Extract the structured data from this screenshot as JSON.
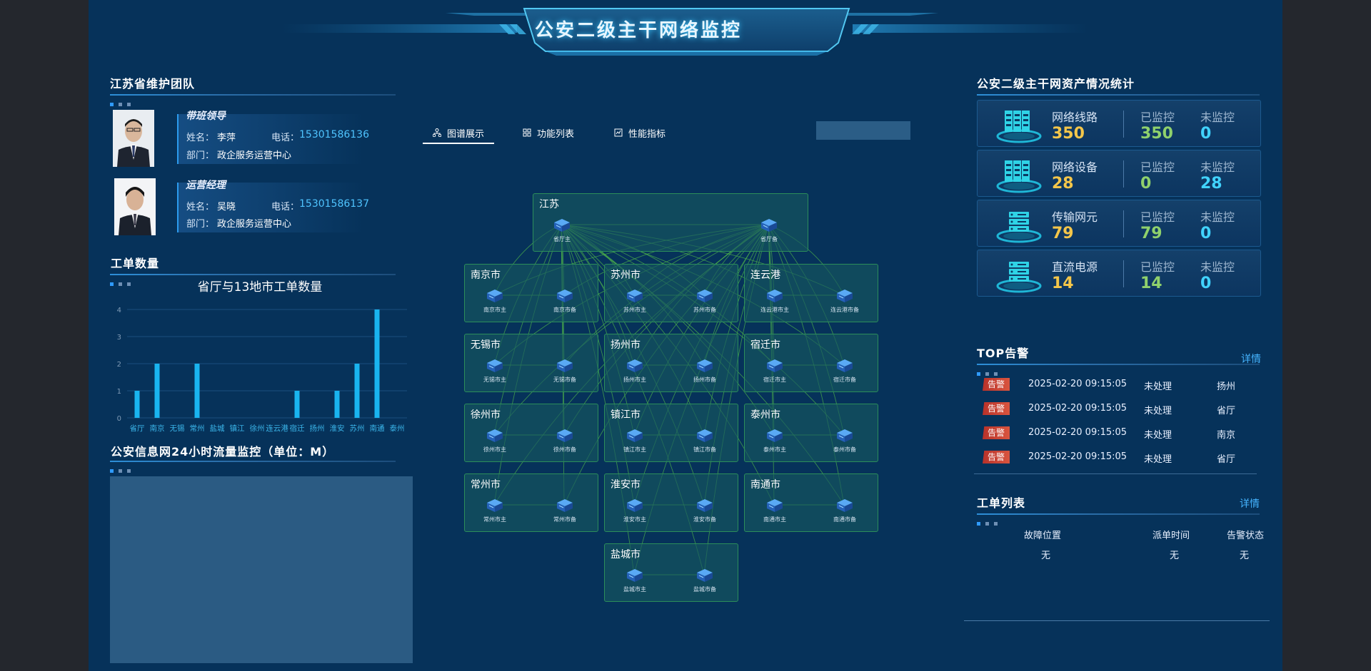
{
  "header": {
    "title": "公安二级主干网络监控"
  },
  "team": {
    "title": "江苏省维护团队",
    "members": [
      {
        "role": "带班领导",
        "name_label": "姓名：",
        "name": "李萍",
        "phone_label": "电话：",
        "phone": "15301586136",
        "dept_label": "部门：",
        "dept": "政企服务运营中心"
      },
      {
        "role": "运营经理",
        "name_label": "姓名：",
        "name": "吴晓",
        "phone_label": "电话：",
        "phone": "15301586137",
        "dept_label": "部门：",
        "dept": "政企服务运营中心"
      }
    ]
  },
  "work_count": {
    "title": "工单数量",
    "chart_data": {
      "type": "bar",
      "title": "省厅与13地市工单数量",
      "categories": [
        "省厅",
        "南京",
        "无锡",
        "常州",
        "盐城",
        "镇江",
        "徐州",
        "连云港",
        "宿迁",
        "扬州",
        "淮安",
        "苏州",
        "南通",
        "泰州"
      ],
      "values": [
        1,
        2,
        0,
        2,
        0,
        0,
        0,
        0,
        1,
        0,
        1,
        2,
        4,
        0
      ],
      "ylim": [
        0,
        4
      ],
      "yticks": [
        0,
        1,
        2,
        3,
        4
      ],
      "color": "#19b4f0"
    }
  },
  "traffic": {
    "title": "公安信息网24小时流量监控（单位：M）"
  },
  "tabs": [
    {
      "label": "图谱展示",
      "icon": "topology-icon",
      "active": true
    },
    {
      "label": "功能列表",
      "icon": "grid-icon",
      "active": false
    },
    {
      "label": "性能指标",
      "icon": "chart-icon",
      "active": false
    }
  ],
  "topology": {
    "province": {
      "name": "江苏",
      "nodes": [
        "省厅主",
        "省厅备"
      ]
    },
    "cities": [
      {
        "name": "南京市",
        "nodes": [
          "南京市主",
          "南京市备"
        ]
      },
      {
        "name": "苏州市",
        "nodes": [
          "苏州市主",
          "苏州市备"
        ]
      },
      {
        "name": "连云港",
        "nodes": [
          "连云港市主",
          "连云港市备"
        ]
      },
      {
        "name": "无锡市",
        "nodes": [
          "无锡市主",
          "无锡市备"
        ]
      },
      {
        "name": "扬州市",
        "nodes": [
          "扬州市主",
          "扬州市备"
        ]
      },
      {
        "name": "宿迁市",
        "nodes": [
          "宿迁市主",
          "宿迁市备"
        ]
      },
      {
        "name": "徐州市",
        "nodes": [
          "徐州市主",
          "徐州市备"
        ]
      },
      {
        "name": "镇江市",
        "nodes": [
          "镇江市主",
          "镇江市备"
        ]
      },
      {
        "name": "泰州市",
        "nodes": [
          "泰州市主",
          "泰州市备"
        ]
      },
      {
        "name": "常州市",
        "nodes": [
          "常州市主",
          "常州市备"
        ]
      },
      {
        "name": "淮安市",
        "nodes": [
          "淮安市主",
          "淮安市备"
        ]
      },
      {
        "name": "南通市",
        "nodes": [
          "南通市主",
          "南通市备"
        ]
      },
      {
        "name": "盐城市",
        "nodes": [
          "盐城市主",
          "盐城市备"
        ]
      }
    ]
  },
  "assets": {
    "title": "公安二级主干网资产情况统计",
    "monitored_label": "已监控",
    "unmonitored_label": "未监控",
    "items": [
      {
        "name": "网络线路",
        "total": "350",
        "monitored": "350",
        "unmonitored": "0",
        "icon": "server-rack-icon"
      },
      {
        "name": "网络设备",
        "total": "28",
        "monitored": "0",
        "unmonitored": "28",
        "icon": "server-rack-icon"
      },
      {
        "name": "传输网元",
        "total": "79",
        "monitored": "79",
        "unmonitored": "0",
        "icon": "server-stack-icon"
      },
      {
        "name": "直流电源",
        "total": "14",
        "monitored": "14",
        "unmonitored": "0",
        "icon": "server-stack-icon"
      }
    ]
  },
  "alarms": {
    "title": "TOP告警",
    "detail": "详情",
    "rows": [
      {
        "badge": "告警",
        "time": "2025-02-20 09:15:05",
        "status": "未处理",
        "location": "扬州"
      },
      {
        "badge": "告警",
        "time": "2025-02-20 09:15:05",
        "status": "未处理",
        "location": "省厅"
      },
      {
        "badge": "告警",
        "time": "2025-02-20 09:15:05",
        "status": "未处理",
        "location": "南京"
      },
      {
        "badge": "告警",
        "time": "2025-02-20 09:15:05",
        "status": "未处理",
        "location": "省厅"
      }
    ]
  },
  "work_orders": {
    "title": "工单列表",
    "detail": "详情",
    "columns": [
      "故障位置",
      "派单时间",
      "告警状态"
    ],
    "rows": [
      [
        "无",
        "无",
        "无"
      ]
    ]
  },
  "colors": {
    "background": "#06325a",
    "accent": "#2f9bff",
    "value_yellow": "#f4c64a",
    "value_green": "#8fd16c",
    "value_cyan": "#41d3ff",
    "link": "#2c8e5a"
  }
}
